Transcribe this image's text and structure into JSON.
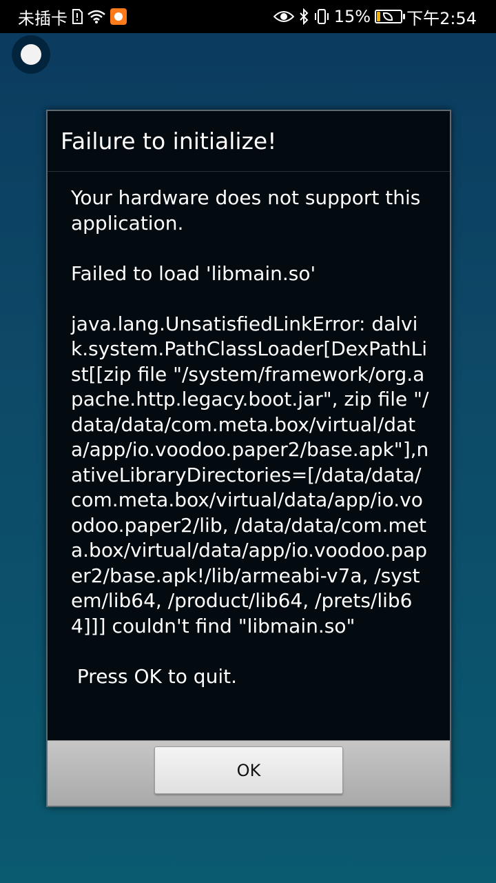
{
  "status_bar": {
    "carrier": "未插卡",
    "battery_percent_text": "15%",
    "battery_level": 0.15,
    "time": "下午2:54",
    "icons": [
      "sim-icon",
      "wifi-icon",
      "app-notification-icon",
      "eye-icon",
      "bluetooth-icon",
      "vibrate-icon",
      "battery-icon"
    ]
  },
  "dialog": {
    "title": "Failure to initialize!",
    "message": "Your hardware does not support this application.\n\nFailed to load 'libmain.so'\n\njava.lang.UnsatisfiedLinkError: dalvik.system.PathClassLoader[DexPathList[[zip file \"/system/framework/org.apache.http.legacy.boot.jar\", zip file \"/data/data/com.meta.box/virtual/data/app/io.voodoo.paper2/base.apk\"],nativeLibraryDirectories=[/data/data/com.meta.box/virtual/data/app/io.voodoo.paper2/lib, /data/data/com.meta.box/virtual/data/app/io.voodoo.paper2/base.apk!/lib/armeabi-v7a, /system/lib64, /product/lib64, /prets/lib64]]] couldn't find \"libmain.so\"\n\n Press OK to quit.",
    "ok_label": "OK"
  },
  "colors": {
    "battery_fill": "#f0b400",
    "app_notification": "#ff7a1a"
  }
}
